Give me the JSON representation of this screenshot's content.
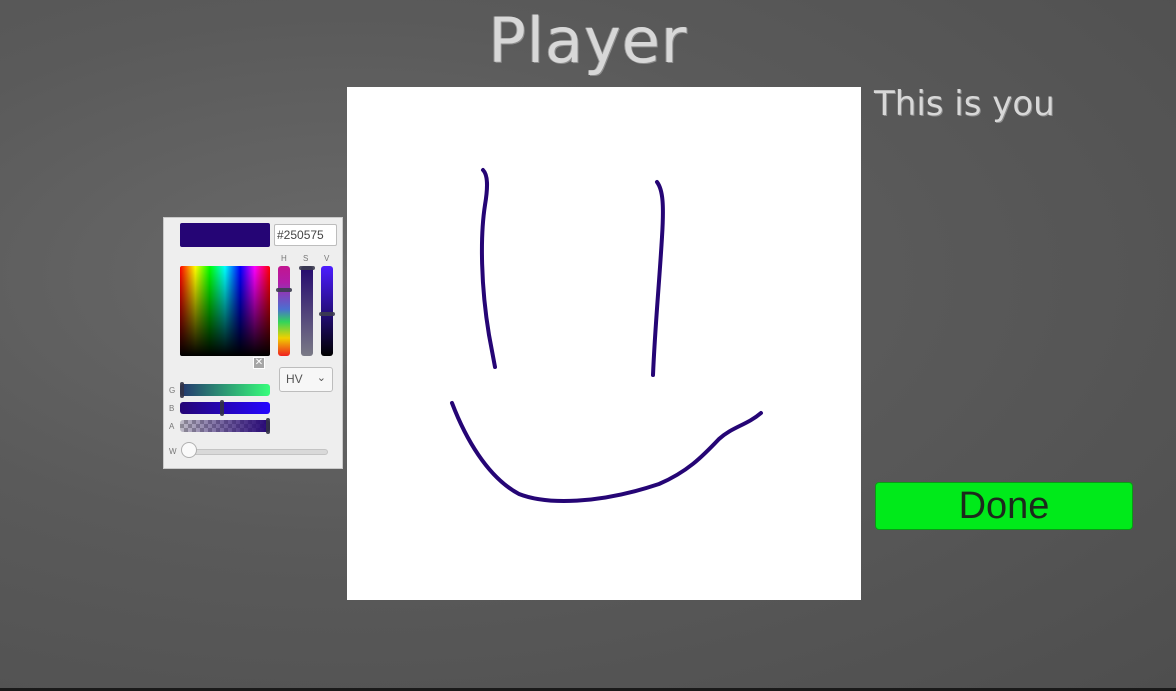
{
  "title": "Player",
  "subtitle": "This is you",
  "done_label": "Done",
  "picker": {
    "hex_value": "#250575",
    "current_color": "#250575",
    "labels": {
      "h": "H",
      "s": "S",
      "v": "V",
      "g": "G",
      "b": "B",
      "a": "A",
      "w": "W"
    },
    "mode_value": "HV",
    "mode_icon": "chevron-down-icon"
  },
  "colors": {
    "stroke": "#250575",
    "done_bg": "#00ea1a",
    "canvas_bg": "#ffffff"
  }
}
